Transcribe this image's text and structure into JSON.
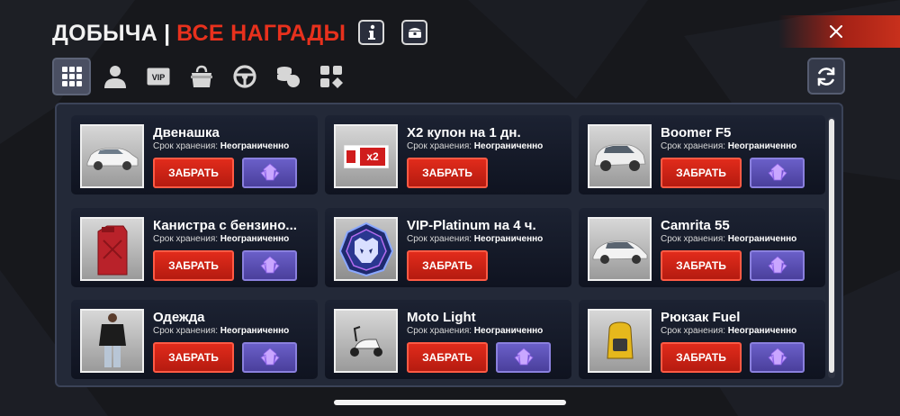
{
  "header": {
    "title_main": "ДОБЫЧА",
    "title_sep": "|",
    "title_accent": "ВСЕ НАГРАДЫ",
    "info_icon": "info-icon",
    "chest_icon": "chest-icon",
    "close_icon": "close-icon"
  },
  "tabs": [
    {
      "icon": "grid-icon",
      "active": true
    },
    {
      "icon": "person-icon",
      "active": false
    },
    {
      "icon": "vip-icon",
      "label": "VIP",
      "active": false
    },
    {
      "icon": "bag-icon",
      "active": false
    },
    {
      "icon": "steering-wheel-icon",
      "active": false
    },
    {
      "icon": "coins-icon",
      "active": false
    },
    {
      "icon": "apps-icon",
      "active": false
    }
  ],
  "refresh_icon": "refresh-icon",
  "storage_label": "Срок хранения:",
  "storage_value": "Неограниченно",
  "claim_label": "ЗАБРАТЬ",
  "items": [
    {
      "name": "Двенашка",
      "thumb": "car-white",
      "crystal": true
    },
    {
      "name": "X2 купон на 1 дн.",
      "thumb": "coupon-x2",
      "badge": "x2",
      "crystal": false
    },
    {
      "name": "Boomer F5",
      "thumb": "car-suv",
      "crystal": true
    },
    {
      "name": "Канистра с бензино...",
      "thumb": "canister",
      "crystal": true
    },
    {
      "name": "VIP-Platinum на 4 ч.",
      "thumb": "vip-bear",
      "crystal": false
    },
    {
      "name": "Camrita 55",
      "thumb": "car-sedan",
      "crystal": true
    },
    {
      "name": "Одежда",
      "thumb": "clothes",
      "crystal": true
    },
    {
      "name": "Moto Light",
      "thumb": "scooter",
      "crystal": true
    },
    {
      "name": "Рюкзак Fuel",
      "thumb": "backpack",
      "crystal": true
    }
  ],
  "colors": {
    "accent": "#e8311d",
    "claim_button": "#c8231a",
    "crystal_button": "#5a4fb8",
    "panel": "#232938",
    "background": "#17181c"
  }
}
